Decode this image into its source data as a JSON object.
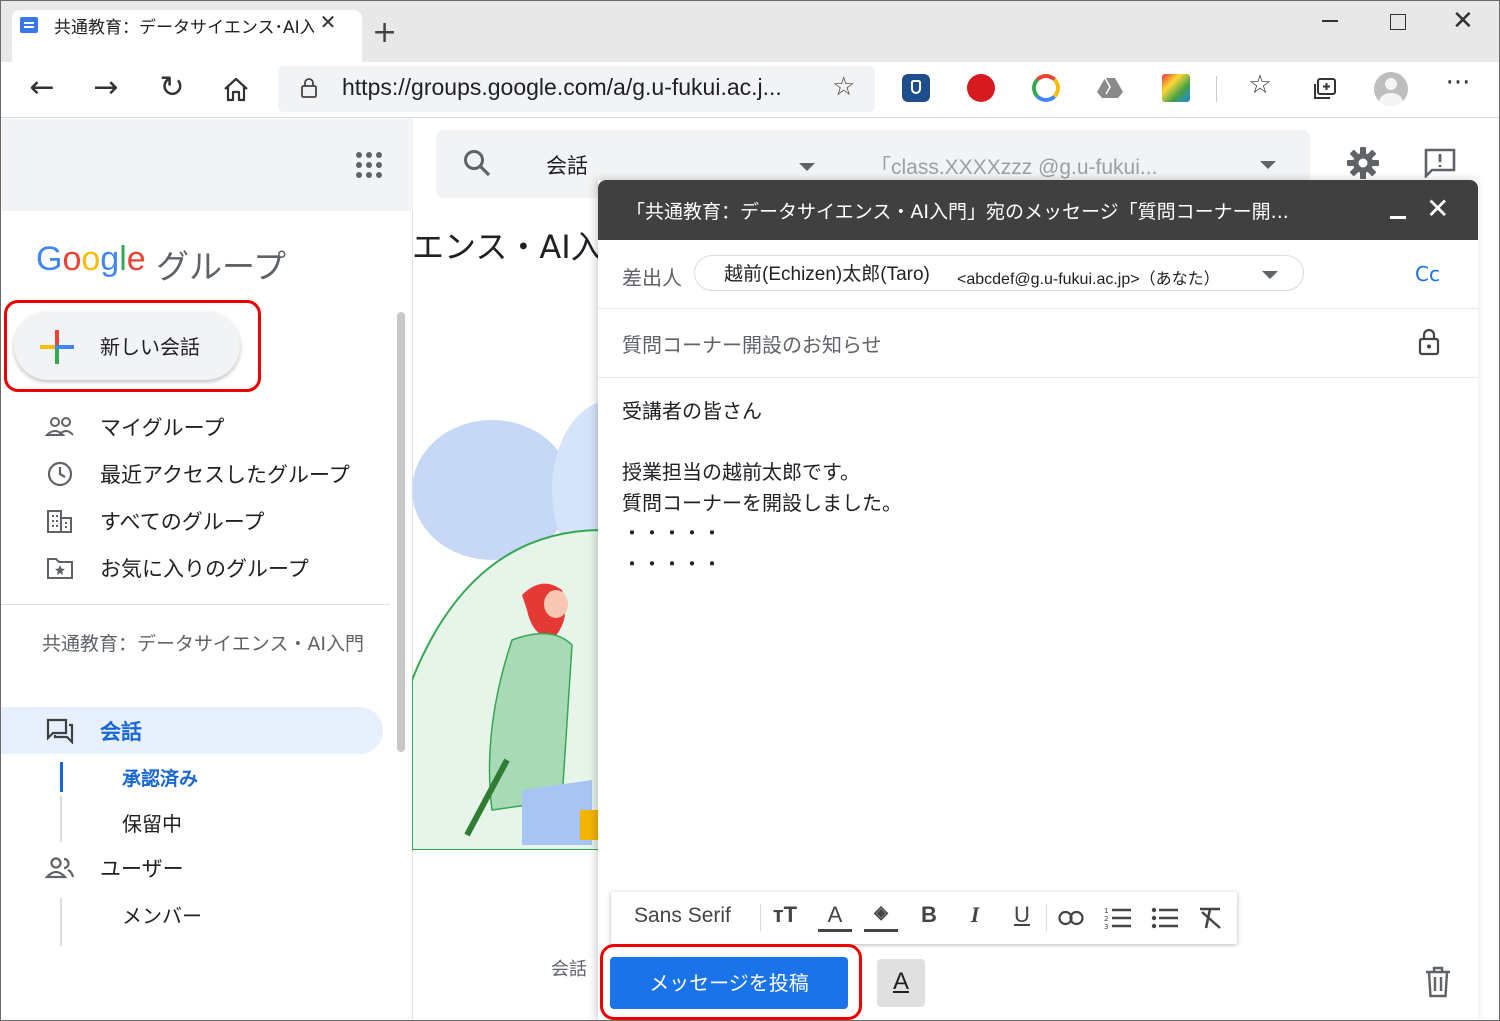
{
  "browser": {
    "tab_title": "共通教育：データサイエンス･AI入門",
    "new_tab": "+",
    "url": "https://groups.google.com/a/g.u-fukui.ac.j...",
    "nav_icons": [
      "back-arrow-icon",
      "forward-arrow-icon",
      "refresh-icon",
      "home-icon"
    ],
    "extension_icons": [
      "shield-extension-icon",
      "trendmicro-icon",
      "chrome-remote-icon",
      "drive-icon",
      "colorful-extension-icon"
    ],
    "toolbar_icons": [
      "favorites-icon",
      "collections-icon",
      "profile-icon",
      "more-icon"
    ]
  },
  "sidebar": {
    "logo_letters": [
      "G",
      "o",
      "o",
      "g",
      "l",
      "e"
    ],
    "product": "グループ",
    "new_conversation": "新しい会話",
    "nav": [
      {
        "label": "マイグループ",
        "icon": "people-icon"
      },
      {
        "label": "最近アクセスしたグループ",
        "icon": "clock-icon"
      },
      {
        "label": "すべてのグループ",
        "icon": "building-icon"
      },
      {
        "label": "お気に入りのグループ",
        "icon": "star-folder-icon"
      }
    ],
    "group_name": "共通教育：データサイエンス・AI入門",
    "conversations": "会話",
    "approved": "承認済み",
    "pending": "保留中",
    "users": "ユーザー",
    "members": "メンバー"
  },
  "main": {
    "search_scope": "会話",
    "search_placeholder": "「class.XXXXzzz @g.u-fukui...",
    "heading_fragment": "エンス・AI入",
    "bottom_text": "会話"
  },
  "compose": {
    "title": "「共通教育：データサイエンス・AI入門」宛のメッセージ「質問コーナー開...",
    "from_label": "差出人",
    "from_name": "越前(Echizen)太郎(Taro)",
    "from_email": "<abcdef@g.u-fukui.ac.jp>（あなた）",
    "cc": "Cc",
    "subject": "質問コーナー開設のお知らせ",
    "body": [
      "受講者の皆さん",
      "",
      "授業担当の越前太郎です。",
      "質問コーナーを開設しました。",
      "・・・・・",
      "・・・・・"
    ],
    "font": "Sans Serif",
    "post_button": "メッセージを投稿",
    "format_toggle": "A"
  },
  "colors": {
    "accent": "#1a73e8",
    "highlight_box": "#e00000",
    "compose_header": "#404040"
  }
}
